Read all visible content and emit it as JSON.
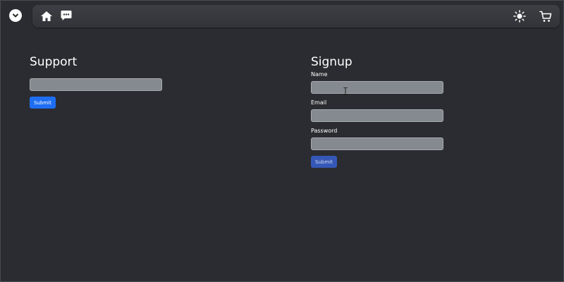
{
  "theme": {
    "background": "#2b2c31",
    "navbar": "#3a3b40",
    "primary": "#1e6ef2",
    "input": "#858990"
  },
  "navbar": {
    "left_icons": [
      "chevron-down-circle-icon",
      "home-icon",
      "chat-icon"
    ],
    "right_icons": [
      "sun-icon",
      "cart-icon"
    ]
  },
  "support": {
    "title": "Support",
    "input_value": "",
    "submit_label": "Submit"
  },
  "signup": {
    "title": "Signup",
    "fields": [
      {
        "label": "Name",
        "value": ""
      },
      {
        "label": "Email",
        "value": ""
      },
      {
        "label": "Password",
        "value": ""
      }
    ],
    "submit_label": "Submit"
  }
}
